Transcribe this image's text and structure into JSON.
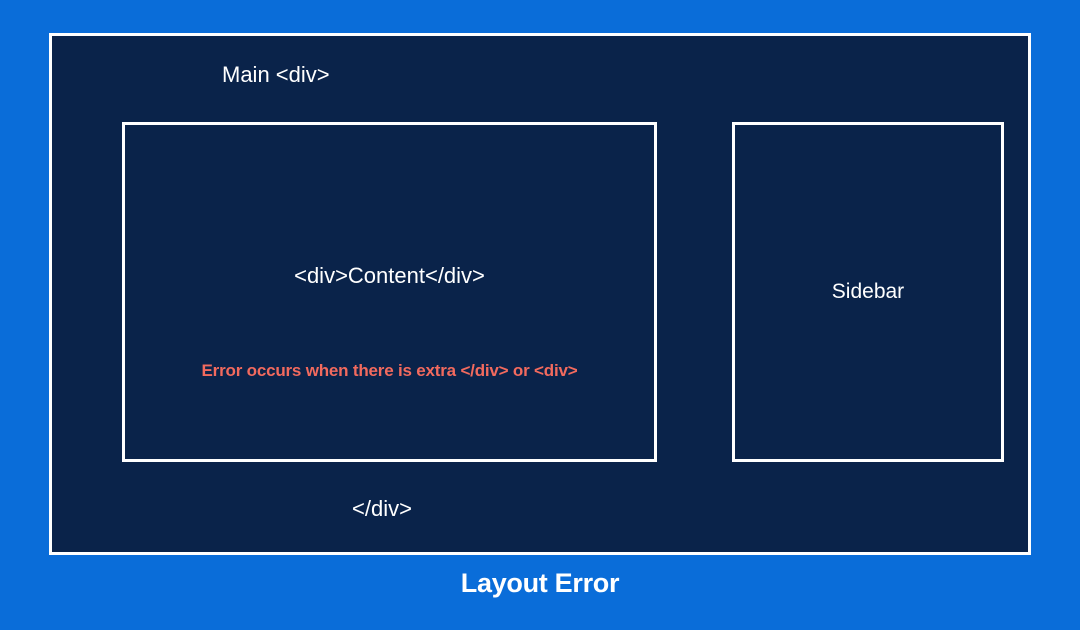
{
  "diagram": {
    "main_label": "Main <div>",
    "content_text": "<div>Content</div>",
    "error_text": "Error occurs when there is extra </div> or <div>",
    "sidebar_text": "Sidebar",
    "closing_div": "</div>",
    "caption": "Layout Error"
  }
}
